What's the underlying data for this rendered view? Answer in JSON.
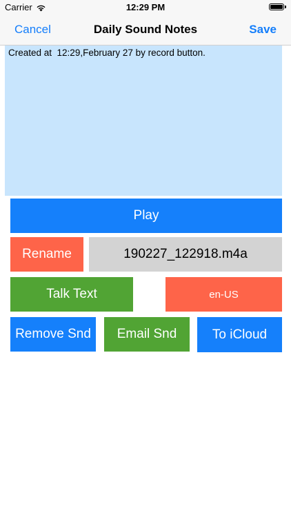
{
  "status_bar": {
    "carrier": "Carrier",
    "time": "12:29 PM",
    "wifi_icon": "wifi-icon",
    "battery_icon": "battery-icon"
  },
  "nav": {
    "cancel_label": "Cancel",
    "title": "Daily Sound Notes",
    "save_label": "Save"
  },
  "note": {
    "text": "Created at  12:29,February 27 by record button."
  },
  "controls": {
    "play_label": "Play",
    "rename_label": "Rename",
    "file_name": "190227_122918.m4a",
    "talk_text_label": "Talk Text",
    "language_label": "en-US",
    "remove_label": "Remove Snd",
    "email_label": "Email Snd",
    "icloud_label": "To iCloud"
  },
  "colors": {
    "accent_blue": "#1580fb",
    "orange": "#fe6449",
    "green": "#51a434",
    "note_background": "#c8e5fd",
    "filename_background": "#d3d3d3"
  }
}
